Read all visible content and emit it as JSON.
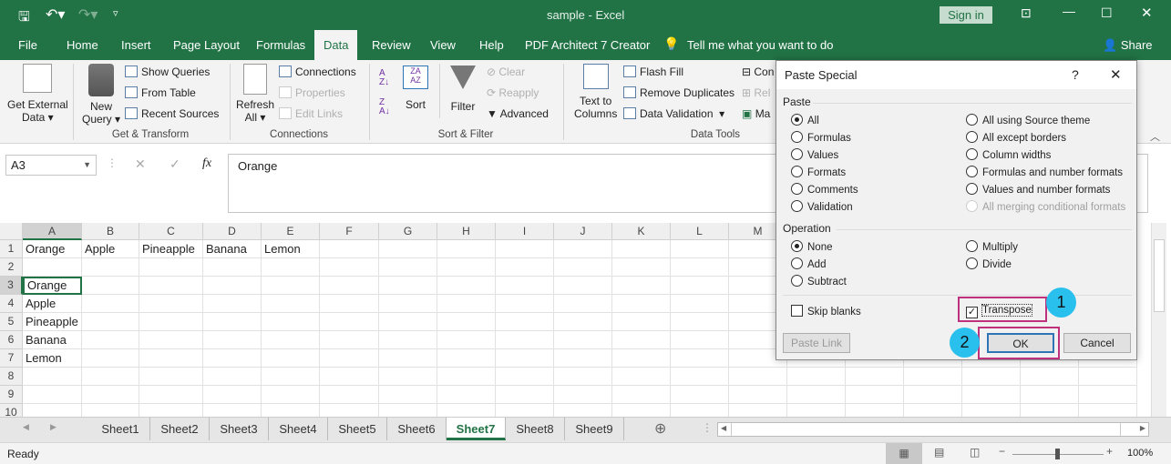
{
  "titlebar": {
    "title": "sample  -  Excel",
    "signin": "Sign in",
    "save_icon": "save-icon",
    "undo_icon": "undo-icon",
    "redo_icon": "redo-icon"
  },
  "tabs": [
    "File",
    "Home",
    "Insert",
    "Page Layout",
    "Formulas",
    "Data",
    "Review",
    "View",
    "Help",
    "PDF Architect 7 Creator"
  ],
  "active_tab": "Data",
  "tell_me": "Tell me what you want to do",
  "share": "Share",
  "ribbon": {
    "get_external_data": [
      "Get External",
      "Data ▾"
    ],
    "new_query": [
      "New",
      "Query ▾"
    ],
    "show_queries": "Show Queries",
    "from_table": "From Table",
    "recent_sources": "Recent Sources",
    "get_transform": "Get & Transform",
    "refresh_all": [
      "Refresh",
      "All ▾"
    ],
    "connections_btn": "Connections",
    "properties": "Properties",
    "edit_links": "Edit Links",
    "connections_group": "Connections",
    "sort": "Sort",
    "filter": "Filter",
    "clear": "Clear",
    "reapply": "Reapply",
    "advanced": "Advanced",
    "sort_filter": "Sort & Filter",
    "text_to_columns": [
      "Text to",
      "Columns"
    ],
    "flash_fill": "Flash Fill",
    "remove_duplicates": "Remove Duplicates",
    "data_validation": "Data Validation",
    "cons": "Con",
    "rel": "Rel",
    "ma": "Ma",
    "data_tools": "Data Tools"
  },
  "formula_bar": {
    "name_box": "A3",
    "fx": "fx",
    "value": "Orange"
  },
  "columns": [
    "A",
    "B",
    "C",
    "D",
    "E",
    "F",
    "G",
    "H",
    "I",
    "J",
    "K",
    "L",
    "M",
    "",
    "",
    "",
    "",
    "",
    ""
  ],
  "rows": [
    [
      "Orange",
      "Apple",
      "Pineapple",
      "Banana",
      "Lemon"
    ],
    [],
    [
      "Orange"
    ],
    [
      "Apple"
    ],
    [
      "Pineapple"
    ],
    [
      "Banana"
    ],
    [
      "Lemon"
    ],
    [],
    [],
    []
  ],
  "sheets": [
    "Sheet1",
    "Sheet2",
    "Sheet3",
    "Sheet4",
    "Sheet5",
    "Sheet6",
    "Sheet7",
    "Sheet8",
    "Sheet9"
  ],
  "active_sheet": "Sheet7",
  "status": {
    "ready": "Ready",
    "zoom": "100%",
    "zoom_level_percent": 100
  },
  "dialog": {
    "title": "Paste Special",
    "help": "?",
    "close": "✕",
    "paste_label": "Paste",
    "paste_left": [
      "All",
      "Formulas",
      "Values",
      "Formats",
      "Comments",
      "Validation"
    ],
    "paste_right": [
      "All using Source theme",
      "All except borders",
      "Column widths",
      "Formulas and number formats",
      "Values and number formats",
      "All merging conditional formats"
    ],
    "paste_selected": "All",
    "operation_label": "Operation",
    "op_left": [
      "None",
      "Add",
      "Subtract"
    ],
    "op_right": [
      "Multiply",
      "Divide"
    ],
    "op_selected": "None",
    "skip_blanks": "Skip blanks",
    "skip_blanks_checked": false,
    "transpose": "Transpose",
    "transpose_checked": true,
    "paste_link": "Paste Link",
    "ok": "OK",
    "cancel": "Cancel",
    "badge1": "1",
    "badge2": "2",
    "highlight_color": "#c0317d",
    "badge_color": "#29c0ee"
  },
  "colors": {
    "excel_green": "#217346"
  }
}
